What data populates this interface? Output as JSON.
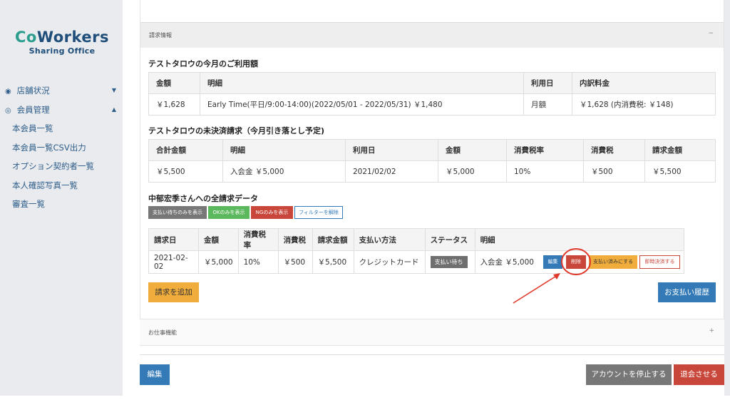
{
  "sidebar": {
    "logo_main_a": "Co",
    "logo_main_b": "Workers",
    "logo_sub": "Sharing Office",
    "items": [
      {
        "label": "店舗状況",
        "icon": "dashboard-icon",
        "caret": "▼"
      },
      {
        "label": "会員管理",
        "icon": "user-circle-icon",
        "caret": "▲"
      },
      {
        "label": "本会員一覧"
      },
      {
        "label": "本会員一覧CSV出力"
      },
      {
        "label": "オプション契約者一覧"
      },
      {
        "label": "本人確認写真一覧"
      },
      {
        "label": "審査一覧"
      }
    ]
  },
  "billing_panel": {
    "title": "請求情報",
    "collapse": "−"
  },
  "usage": {
    "title": "テストタロウの今月のご利用額",
    "headers": [
      "金額",
      "明細",
      "利用日",
      "内訳料金"
    ],
    "row": [
      "￥1,628",
      "Early Time(平日/9:00-14:00)(2022/05/01 - 2022/05/31) ￥1,480",
      "月額",
      "￥1,628 (内消費税: ￥148)"
    ]
  },
  "unsettled": {
    "title": "テストタロウの未決済請求（今月引き落とし予定)",
    "headers": [
      "合計金額",
      "明細",
      "利用日",
      "金額",
      "消費税率",
      "消費税",
      "請求金額"
    ],
    "row": [
      "￥5,500",
      "入会金 ￥5,000",
      "2021/02/02",
      "￥5,000",
      "10%",
      "￥500",
      "￥5,500"
    ]
  },
  "all_bills": {
    "title": "中郁宏季さんへの全請求データ",
    "filters": {
      "pending": "支払い待ちのみを表示",
      "ok": "OKのみを表示",
      "ng": "NGのみを表示",
      "clear": "フィルターを解除"
    },
    "headers": [
      "請求日",
      "金額",
      "消費税率",
      "消費税",
      "請求金額",
      "支払い方法",
      "ステータス",
      "明細"
    ],
    "row": {
      "date": "2021-02-02",
      "amount": "￥5,000",
      "tax_rate": "10%",
      "tax": "￥500",
      "billed": "￥5,500",
      "method": "クレジットカード",
      "status": "支払い待ち",
      "detail": "入会金 ￥5,000"
    },
    "row_actions": {
      "edit": "編集",
      "delete": "削除",
      "mark_paid": "支払い済みにする",
      "settle_now": "即時決済する"
    },
    "add_bill": "請求を追加",
    "history": "お支払い履歴"
  },
  "jobs_panel": {
    "title": "お仕事機能",
    "expand": "+"
  },
  "footer": {
    "edit": "編集",
    "suspend": "アカウントを停止する",
    "withdraw": "退会させる"
  },
  "colors": {
    "primary": "#337ab7",
    "danger": "#c9473a",
    "warning": "#f0ad3c",
    "success": "#5cb85c",
    "gray": "#777777",
    "annotation": "#e0392b"
  }
}
